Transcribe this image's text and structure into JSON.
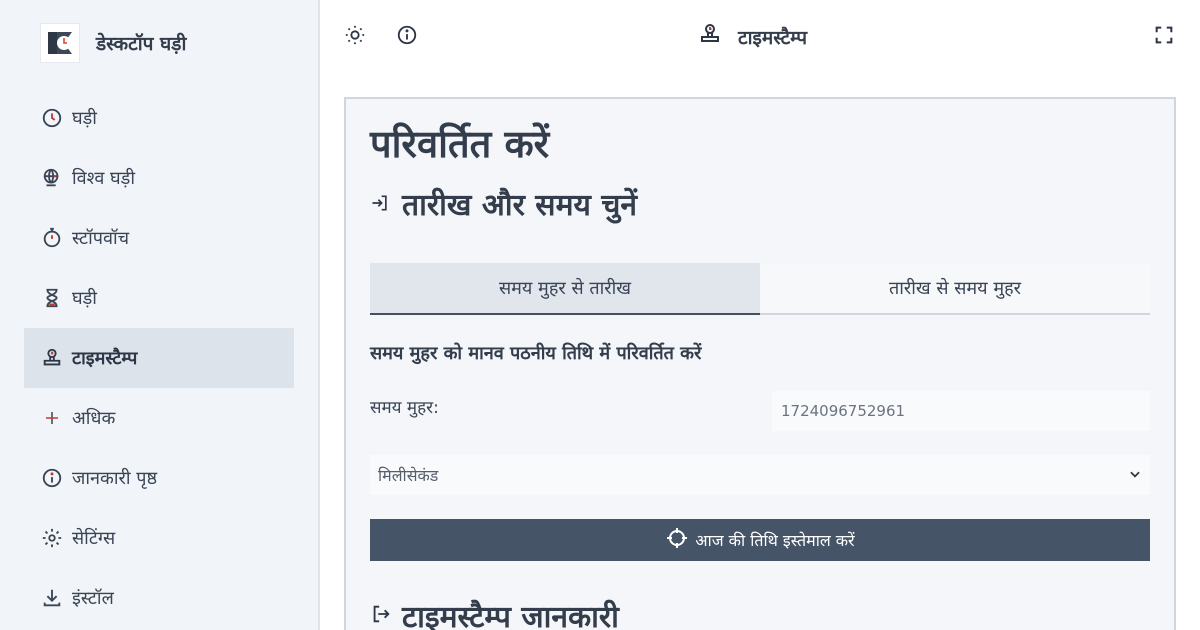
{
  "app": {
    "name": "डेस्कटॉप घड़ी"
  },
  "sidebar": {
    "items": [
      {
        "label": "घड़ी",
        "icon": "clock-icon",
        "active": false
      },
      {
        "label": "विश्व घड़ी",
        "icon": "world-clock-icon",
        "active": false
      },
      {
        "label": "स्टॉपवॉच",
        "icon": "stopwatch-icon",
        "active": false
      },
      {
        "label": "घड़ी",
        "icon": "hourglass-icon",
        "active": false
      },
      {
        "label": "टाइमस्टैम्प",
        "icon": "stamp-icon",
        "active": true
      },
      {
        "label": "अधिक",
        "icon": "plus-icon",
        "active": false
      },
      {
        "label": "जानकारी पृष्ठ",
        "icon": "info-icon",
        "active": false
      },
      {
        "label": "सेटिंग्स",
        "icon": "gear-icon",
        "active": false
      },
      {
        "label": "इंस्टॉल",
        "icon": "download-icon",
        "active": false
      }
    ]
  },
  "header": {
    "title": "टाइमस्टैम्प"
  },
  "main": {
    "title": "परिवर्तित करें",
    "section_title": "तारीख और समय चुनें",
    "tabs": [
      {
        "label": "समय मुहर से तारीख",
        "active": true
      },
      {
        "label": "तारीख से समय मुहर",
        "active": false
      }
    ],
    "subheading": "समय मुहर को मानव पठनीय तिथि में परिवर्तित करें",
    "timestamp_label": "समय मुहर:",
    "timestamp_value": "1724096752961",
    "unit_selected": "मिलीसेकंड",
    "now_button": "आज की तिथि इस्तेमाल करें",
    "info_title": "टाइमस्टैम्प जानकारी"
  },
  "colors": {
    "accent": "#465467",
    "sidebar_bg": "#f1f4f8",
    "active_bg": "#dde3ea",
    "logo_red": "#d9423a"
  }
}
